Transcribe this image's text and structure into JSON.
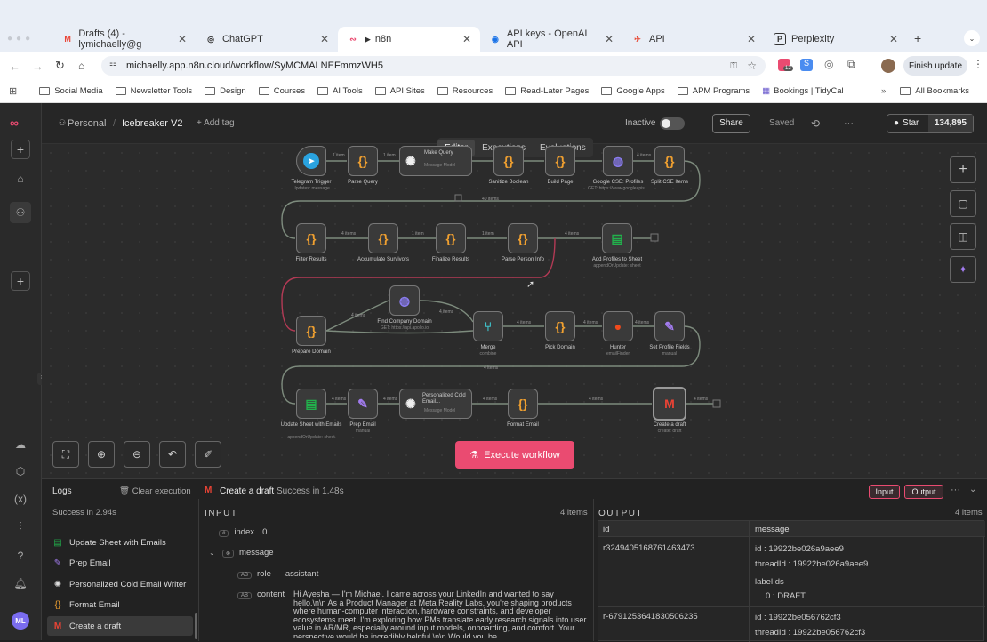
{
  "browser": {
    "tabs": [
      {
        "title": "Drafts (4) - lymichaelly@g",
        "fav": "M",
        "favColor": "#ea4335"
      },
      {
        "title": "ChatGPT",
        "fav": "◎",
        "favColor": "#222"
      },
      {
        "title": "n8n",
        "fav": "▸",
        "favColor": "#ea4b71"
      },
      {
        "title": "API keys - OpenAI API",
        "fav": "◉",
        "favColor": "#1a73e8"
      },
      {
        "title": "API",
        "fav": "✈",
        "favColor": "#e8412b"
      },
      {
        "title": "Perplexity",
        "fav": "P",
        "favColor": "#222"
      }
    ],
    "url": "michaelly.app.n8n.cloud/workflow/SyMCMALNEFmmzWH5",
    "finish_update": "Finish update",
    "ext_badge": "12",
    "bookmarks": [
      "Social Media",
      "Newsletter Tools",
      "Design",
      "Courses",
      "AI Tools",
      "API Sites",
      "Resources",
      "Read-Later Pages",
      "Google Apps",
      "APM Programs",
      "Bookings | TidyCal"
    ],
    "all_bookmarks": "All Bookmarks"
  },
  "topbar": {
    "scope": "Personal",
    "workflow_name": "Icebreaker V2",
    "add_tag": "+ Add tag",
    "inactive": "Inactive",
    "share": "Share",
    "saved": "Saved",
    "star": "Star",
    "star_count": "134,895",
    "tabs": [
      "Editor",
      "Executions",
      "Evaluations"
    ]
  },
  "canvas": {
    "execute_label": "Execute workflow",
    "nodes_row1": [
      {
        "label": "Telegram Trigger",
        "sub": "Updates: message",
        "icon": "➤",
        "color": "#2aa3e0"
      },
      {
        "label": "Parse Query",
        "sub": "",
        "icon": "{}",
        "color": "#f0a030"
      },
      {
        "label": "Make Query",
        "sub": "Message Model",
        "icon": "✺",
        "color": "#eee"
      },
      {
        "label": "Sanitize Boolean",
        "sub": "",
        "icon": "{}",
        "color": "#f0a030"
      },
      {
        "label": "Build Page",
        "sub": "",
        "icon": "{}",
        "color": "#f0a030"
      },
      {
        "label": "Google CSE: Profiles",
        "sub": "GET: https://www.googleapis...",
        "icon": "◍",
        "color": "#8a7cf0"
      },
      {
        "label": "Split CSE Items",
        "sub": "",
        "icon": "{}",
        "color": "#f0a030"
      }
    ],
    "nodes_row2": [
      {
        "label": "Filter Results",
        "sub": "",
        "icon": "{}",
        "color": "#f0a030"
      },
      {
        "label": "Accumulate Survivors",
        "sub": "",
        "icon": "{}",
        "color": "#f0a030"
      },
      {
        "label": "Finalize Results",
        "sub": "",
        "icon": "{}",
        "color": "#f0a030"
      },
      {
        "label": "Parse Person Info",
        "sub": "",
        "icon": "{}",
        "color": "#f0a030"
      },
      {
        "label": "Add Profiles to Sheet",
        "sub": "appendOrUpdate: sheet",
        "icon": "▤",
        "color": "#22b14c"
      }
    ],
    "nodes_row3": [
      {
        "label": "Prepare Domain",
        "sub": "",
        "icon": "{}",
        "color": "#f0a030"
      },
      {
        "label": "Find Company Domain",
        "sub": "GET: https://api.apollo.io",
        "icon": "◍",
        "color": "#8a7cf0"
      },
      {
        "label": "Merge",
        "sub": "combine",
        "icon": "⑂",
        "color": "#3fc1c9"
      },
      {
        "label": "Pick Domain",
        "sub": "",
        "icon": "{}",
        "color": "#f0a030"
      },
      {
        "label": "Hunter",
        "sub": "emailFinder",
        "icon": "●",
        "color": "#f04a1c"
      },
      {
        "label": "Set Profile Fields",
        "sub": "manual",
        "icon": "✎",
        "color": "#a37cf0"
      }
    ],
    "nodes_row4": [
      {
        "label": "Update Sheet with Emails",
        "sub": "appendOrUpdate: sheet",
        "icon": "▤",
        "color": "#22b14c"
      },
      {
        "label": "Prep Email",
        "sub": "manual",
        "icon": "✎",
        "color": "#a37cf0"
      },
      {
        "label": "Personalized Cold Email...",
        "sub": "Message Model",
        "icon": "✺",
        "color": "#eee"
      },
      {
        "label": "Format Email",
        "sub": "",
        "icon": "{}",
        "color": "#f0a030"
      },
      {
        "label": "Create a draft",
        "sub": "create: draft",
        "icon": "M",
        "color": "#ea4335"
      }
    ],
    "edges": {
      "one_item": "1 item",
      "four_items": "4 items",
      "forty_items": "40 items"
    }
  },
  "logs": {
    "title": "Logs",
    "clear": "Clear execution",
    "success_total": "Success in 2.94s",
    "node_name": "Create a draft",
    "node_status": "Success in 1.48s",
    "btn_input": "Input",
    "btn_output": "Output",
    "items": [
      {
        "label": "Update Sheet with Emails",
        "icon": "▤",
        "color": "#22b14c"
      },
      {
        "label": "Prep Email",
        "icon": "✎",
        "color": "#a37cf0"
      },
      {
        "label": "Personalized Cold Email Writer",
        "icon": "✺",
        "color": "#eee"
      },
      {
        "label": "Format Email",
        "icon": "{}",
        "color": "#f0a030"
      },
      {
        "label": "Create a draft",
        "icon": "M",
        "color": "#ea4335"
      }
    ],
    "input": {
      "title": "INPUT",
      "count": "4 items",
      "index_key": "index",
      "index_val": "0",
      "message_key": "message",
      "role_key": "role",
      "role_val": "assistant",
      "content_key": "content",
      "content_val": "Hi Ayesha — I'm Michael. I came across your LinkedIn and wanted to say hello.\\n\\n As a Product Manager at Meta Reality Labs, you're shaping products where human-computer interaction, hardware constraints, and developer ecosystems meet. I'm exploring how PMs translate early research signals into user value in AR/MR, especially around input models, onboarding, and comfort. Your perspective would be incredibly helpful.\\n\\n Would you be"
    },
    "output": {
      "title": "OUTPUT",
      "count": "4 items",
      "col_id": "id",
      "col_message": "message",
      "rows": [
        {
          "id": "r3249405168761463473",
          "msg_id": "19922be026a9aee9",
          "thread_id": "19922be026a9aee9",
          "label_key": "labelIds",
          "label_idx": "0",
          "label_val": "DRAFT"
        },
        {
          "id": "r-6791253641830506235",
          "msg_id": "19922be056762cf3",
          "thread_id": "19922be056762cf3"
        }
      ],
      "id_key": "id",
      "thread_key": "threadId"
    }
  }
}
